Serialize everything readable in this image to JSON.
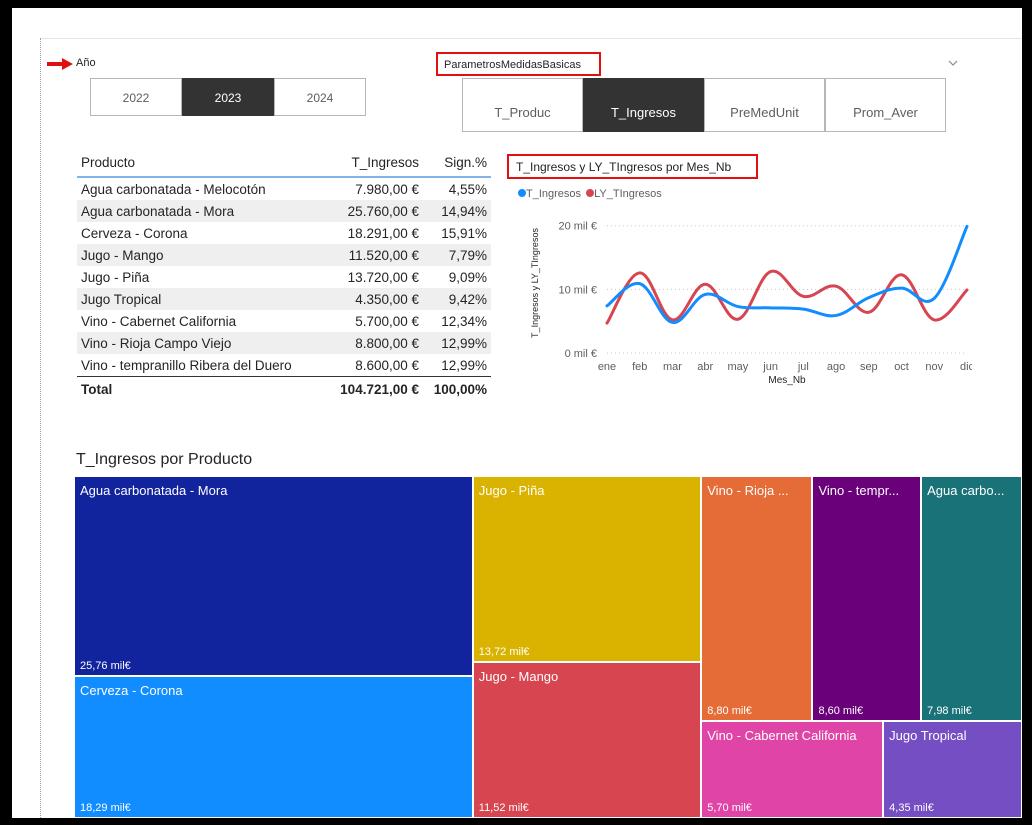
{
  "slicer": {
    "label": "Año",
    "years": [
      "2022",
      "2023",
      "2024"
    ],
    "selected": "2023"
  },
  "param": {
    "label": "ParametrosMedidasBasicas",
    "options": [
      "T_Produc",
      "T_Ingresos",
      "PreMedUnit",
      "Prom_Aver"
    ],
    "selected": "T_Ingresos"
  },
  "table": {
    "headers": [
      "Producto",
      "T_Ingresos",
      "Sign.%"
    ],
    "rows": [
      [
        "Agua carbonatada - Melocotón",
        "7.980,00 €",
        "4,55%"
      ],
      [
        "Agua carbonatada - Mora",
        "25.760,00 €",
        "14,94%"
      ],
      [
        "Cerveza - Corona",
        "18.291,00 €",
        "15,91%"
      ],
      [
        "Jugo - Mango",
        "11.520,00 €",
        "7,79%"
      ],
      [
        "Jugo - Piña",
        "13.720,00 €",
        "9,09%"
      ],
      [
        "Jugo Tropical",
        "4.350,00 €",
        "9,42%"
      ],
      [
        "Vino - Cabernet California",
        "5.700,00 €",
        "12,34%"
      ],
      [
        "Vino - Rioja Campo Viejo",
        "8.800,00 €",
        "12,99%"
      ],
      [
        "Vino - tempranillo Ribera del Duero",
        "8.600,00 €",
        "12,99%"
      ]
    ],
    "total": [
      "Total",
      "104.721,00 €",
      "100,00%"
    ]
  },
  "colors": {
    "blue": "#118DFF",
    "red": "#D64550",
    "selected_btn": "#333333",
    "highlight_box": "#E01010"
  },
  "chart_data": [
    {
      "type": "line",
      "title": "T_Ingresos y LY_TIngresos por Mes_Nb",
      "xlabel": "Mes_Nb",
      "ylabel": "T_Ingresos y LY_TIngresos",
      "categories": [
        "ene",
        "feb",
        "mar",
        "abr",
        "may",
        "jun",
        "jul",
        "ago",
        "sep",
        "oct",
        "nov",
        "dic"
      ],
      "yticks": [
        "0 mil €",
        "10 mil €",
        "20 mil €"
      ],
      "ylim": [
        0,
        22000
      ],
      "series": [
        {
          "name": "T_Ingresos",
          "color": "#118DFF",
          "values": [
            7400,
            10900,
            4800,
            9200,
            7300,
            7100,
            6900,
            5900,
            8700,
            10200,
            8600,
            19900
          ]
        },
        {
          "name": "LY_TIngresos",
          "color": "#D64550",
          "values": [
            4700,
            12600,
            5200,
            10800,
            5300,
            12800,
            8900,
            10500,
            6400,
            12300,
            5200,
            9900
          ]
        }
      ],
      "legend": "top-left"
    },
    {
      "type": "treemap",
      "title": "T_Ingresos por Producto",
      "items": [
        {
          "label": "Agua carbonatada - Mora",
          "value_label": "25,76 mil€",
          "value": 25760,
          "color": "#12239E"
        },
        {
          "label": "Cerveza - Corona",
          "value_label": "18,29 mil€",
          "value": 18291,
          "color": "#118DFF"
        },
        {
          "label": "Jugo - Piña",
          "value_label": "13,72 mil€",
          "value": 13720,
          "color": "#D9B300"
        },
        {
          "label": "Jugo - Mango",
          "value_label": "11,52 mil€",
          "value": 11520,
          "color": "#D64550"
        },
        {
          "label": "Vino - Rioja ...",
          "value_label": "8,80 mil€",
          "value": 8800,
          "color": "#E66C37"
        },
        {
          "label": "Vino - tempr...",
          "value_label": "8,60 mil€",
          "value": 8600,
          "color": "#6B007B"
        },
        {
          "label": "Agua carbo...",
          "value_label": "7,98 mil€",
          "value": 7980,
          "color": "#197278"
        },
        {
          "label": "Vino - Cabernet California",
          "value_label": "5,70 mil€",
          "value": 5700,
          "color": "#E044A7"
        },
        {
          "label": "Jugo Tropical",
          "value_label": "4,35 mil€",
          "value": 4350,
          "color": "#744EC2"
        }
      ]
    }
  ]
}
